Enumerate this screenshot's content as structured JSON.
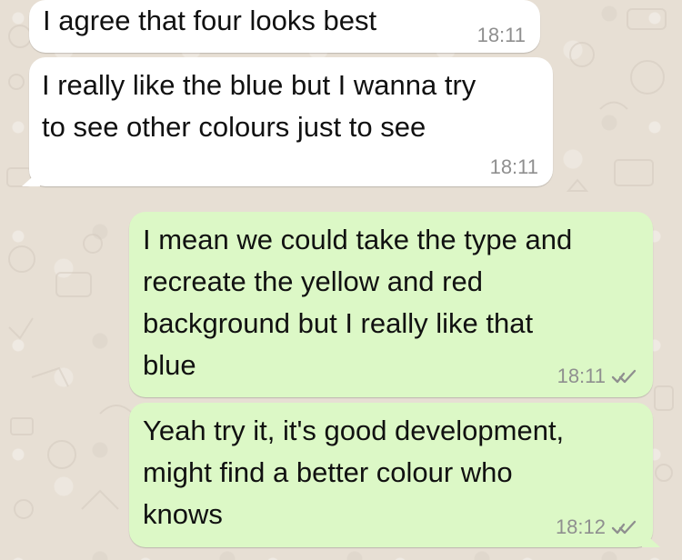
{
  "messages": [
    {
      "direction": "incoming",
      "text": "I agree that four looks best",
      "time": "18:11"
    },
    {
      "direction": "incoming",
      "text": "I really like the blue but I wanna try\nto see other colours just to see",
      "time": "18:11"
    },
    {
      "direction": "outgoing",
      "text": "I mean we could take the type and\nrecreate the yellow and red\nbackground but I really like that\nblue",
      "time": "18:11",
      "status_icon": "double-check-icon"
    },
    {
      "direction": "outgoing",
      "text": "Yeah try it, it's good development,\nmight find a better colour who\nknows",
      "time": "18:12",
      "status_icon": "double-check-icon"
    }
  ],
  "colors": {
    "incoming_bubble": "#ffffff",
    "outgoing_bubble": "#dcf8c6",
    "wallpaper": "#e7dfd4",
    "meta_text": "#8f8f8f",
    "ticks": "#8f8f8f"
  }
}
